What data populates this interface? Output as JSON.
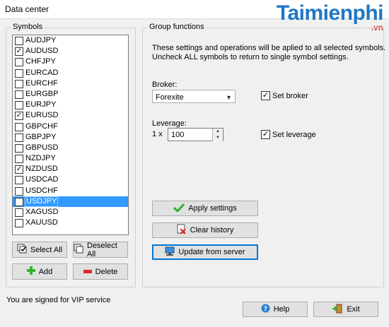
{
  "window": {
    "title": "Data center"
  },
  "watermark": {
    "main": "Taimienphi",
    "sub": ".vn"
  },
  "symbols": {
    "legend": "Symbols",
    "items": [
      {
        "name": "AUDJPY",
        "checked": false,
        "selected": false
      },
      {
        "name": "AUDUSD",
        "checked": true,
        "selected": false
      },
      {
        "name": "CHFJPY",
        "checked": false,
        "selected": false
      },
      {
        "name": "EURCAD",
        "checked": false,
        "selected": false
      },
      {
        "name": "EURCHF",
        "checked": false,
        "selected": false
      },
      {
        "name": "EURGBP",
        "checked": false,
        "selected": false
      },
      {
        "name": "EURJPY",
        "checked": false,
        "selected": false
      },
      {
        "name": "EURUSD",
        "checked": true,
        "selected": false
      },
      {
        "name": "GBPCHF",
        "checked": false,
        "selected": false
      },
      {
        "name": "GBPJPY",
        "checked": false,
        "selected": false
      },
      {
        "name": "GBPUSD",
        "checked": false,
        "selected": false
      },
      {
        "name": "NZDJPY",
        "checked": false,
        "selected": false
      },
      {
        "name": "NZDUSD",
        "checked": true,
        "selected": false
      },
      {
        "name": "USDCAD",
        "checked": false,
        "selected": false
      },
      {
        "name": "USDCHF",
        "checked": false,
        "selected": false
      },
      {
        "name": "USDJPY",
        "checked": true,
        "selected": true
      },
      {
        "name": "XAGUSD",
        "checked": false,
        "selected": false
      },
      {
        "name": "XAUUSD",
        "checked": false,
        "selected": false
      }
    ],
    "select_all_label": "Select All",
    "deselect_all_label": "Deselect All",
    "add_label": "Add",
    "delete_label": "Delete"
  },
  "group": {
    "legend": "Group functions",
    "info_line1": "These settings and operations will be aplied to all selected symbols.",
    "info_line2": "Uncheck ALL symbols to return to single symbol settings.",
    "broker_label": "Broker:",
    "broker_value": "Forexite",
    "set_broker_label": "Set broker",
    "set_broker_checked": true,
    "leverage_label": "Leverage:",
    "leverage_prefix": "1 x",
    "leverage_value": "100",
    "set_leverage_label": "Set leverage",
    "set_leverage_checked": true,
    "apply_label": "Apply settings",
    "clear_label": "Clear history",
    "update_label": "Update from server"
  },
  "footer": {
    "status": "You are signed for VIP service",
    "help_label": "Help",
    "exit_label": "Exit"
  },
  "colors": {
    "selection": "#3399ff",
    "accent": "#0078d7",
    "brand": "#1f77c4"
  }
}
